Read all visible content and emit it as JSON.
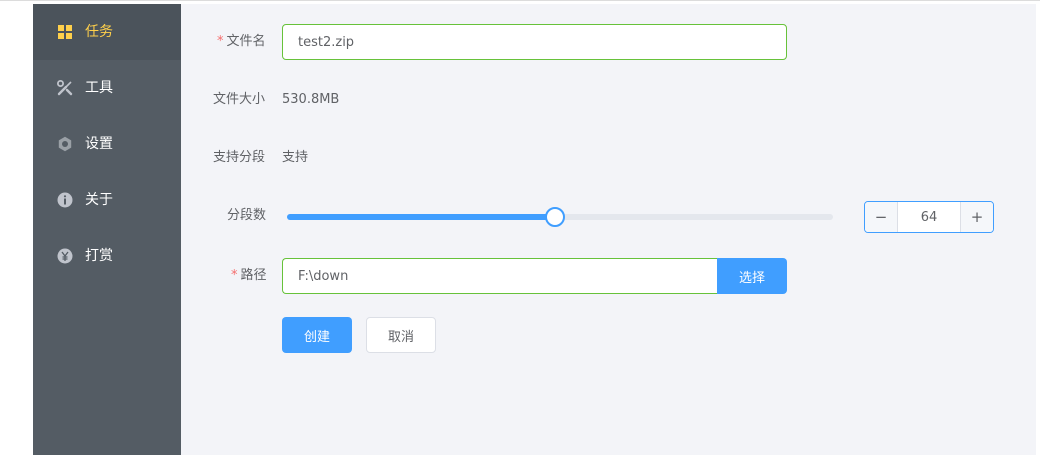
{
  "sidebar": {
    "items": [
      {
        "label": "任务",
        "icon": "grid-icon",
        "active": true
      },
      {
        "label": "工具",
        "icon": "tools-icon",
        "active": false
      },
      {
        "label": "设置",
        "icon": "gear-icon",
        "active": false
      },
      {
        "label": "关于",
        "icon": "info-icon",
        "active": false
      },
      {
        "label": "打赏",
        "icon": "yuan-icon",
        "active": false
      }
    ],
    "colors": {
      "background": "#545c64",
      "active_text": "#ffd04b"
    }
  },
  "form": {
    "filename": {
      "required_mark": "*",
      "label": "文件名",
      "value": "test2.zip"
    },
    "filesize": {
      "label": "文件大小",
      "value": "530.8MB"
    },
    "segment_support": {
      "label": "支持分段",
      "value": "支持"
    },
    "segments": {
      "label": "分段数",
      "value": "64",
      "slider_fraction": 0.49,
      "minus": "−",
      "plus": "+"
    },
    "path": {
      "required_mark": "*",
      "label": "路径",
      "value": "F:\\down",
      "select_label": "选择"
    },
    "create_label": "创建",
    "cancel_label": "取消"
  },
  "colors": {
    "accent": "#409eff",
    "success_border": "#67c23a",
    "required": "#f56c6c"
  }
}
